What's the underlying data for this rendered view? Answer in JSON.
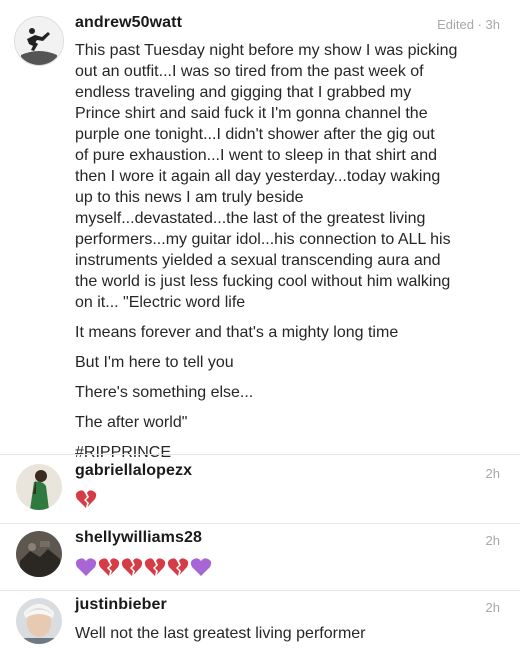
{
  "post": {
    "username": "andrew50watt",
    "edited": "Edited",
    "dot": "·",
    "time": "3h",
    "lines": [
      "This past Tuesday night before my show I was picking",
      "out an outfit...I was so tired from the past week of",
      "endless traveling and gigging that I grabbed my",
      "Prince shirt and said fuck it I'm gonna channel the",
      "purple one tonight...I didn't shower after the gig out",
      "of pure exhaustion...I went to sleep in that shirt and",
      "then I wore it again all day yesterday...today waking",
      "up to this news I am truly beside",
      "myself...devastated...the last of the greatest living",
      "performers...my guitar idol...his connection to ALL his",
      "instruments yielded a sexual transcending aura and",
      "the world is just less fucking cool without him walking",
      "on it... \"Electric word life"
    ],
    "verse1": "It means forever and that's a mighty long time",
    "verse2": "But I'm here to tell you",
    "verse3": "There's something else...",
    "verse4": "The after world\"",
    "hashtag": "#RIPPRINCE"
  },
  "comments": [
    {
      "username": "gabriellalopezx",
      "time": "2h",
      "emojis": [
        "broken-heart"
      ]
    },
    {
      "username": "shellywilliams28",
      "time": "2h",
      "emojis": [
        "purple-heart",
        "broken-heart",
        "broken-heart",
        "broken-heart",
        "broken-heart",
        "purple-heart"
      ]
    },
    {
      "username": "justinbieber",
      "time": "2h",
      "text": "Well not the last greatest living performer"
    }
  ],
  "colors": {
    "broken_heart": "#d63c45",
    "purple_heart": "#a865d6",
    "meta_gray": "#a8a8a8"
  }
}
